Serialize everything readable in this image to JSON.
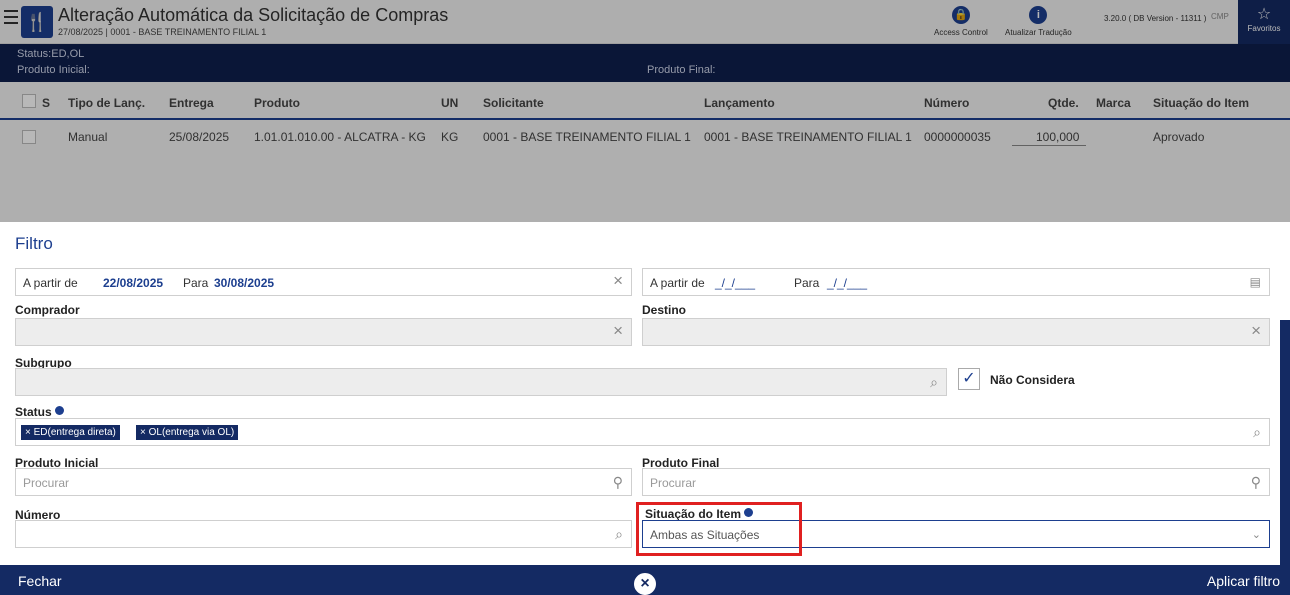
{
  "window": {
    "title": "Alteração Automática da Solicitação de Compras",
    "subtitle": "27/08/2025 | 0001 - BASE TREINAMENTO FILIAL 1",
    "access_control": "Access Control",
    "atualizar_traducao": "Atualizar Tradução",
    "version": "3.20.0 ( DB Version - 11311 )",
    "cmp": "CMP",
    "favoritos": "Favoritos"
  },
  "status_bar": {
    "status": "Status:ED,OL",
    "produto_inicial": "Produto Inicial:",
    "produto_final": "Produto Final:"
  },
  "grid": {
    "headers": [
      "S",
      "Tipo de Lanç.",
      "Entrega",
      "Produto",
      "UN",
      "Solicitante",
      "Lançamento",
      "Número",
      "Qtde.",
      "Marca",
      "Situação do Item"
    ],
    "row": {
      "tipo": "Manual",
      "entrega": "25/08/2025",
      "produto": "1.01.01.010.00 - ALCATRA - KG",
      "un": "KG",
      "solicitante": "0001 - BASE TREINAMENTO FILIAL 1",
      "lancamento": "0001 - BASE TREINAMENTO FILIAL 1",
      "numero": "0000000035",
      "qtde": "100,000",
      "marca": "",
      "situacao": "Aprovado"
    }
  },
  "filter": {
    "title": "Filtro",
    "date1": {
      "prefix": "A partir de",
      "from": "22/08/2025",
      "mid": "Para",
      "to": "30/08/2025"
    },
    "date2": {
      "prefix": "A partir de",
      "from": "_/_/___",
      "mid": "Para",
      "to": "_/_/___"
    },
    "comprador_label": "Comprador",
    "destino_label": "Destino",
    "subgrupo_label": "Subgrupo",
    "nao_considera": "Não Considera",
    "status_label": "Status",
    "status_chips": [
      "× ED(entrega direta)",
      "× OL(entrega via OL)"
    ],
    "produto_inicial_label": "Produto Inicial",
    "produto_final_label": "Produto Final",
    "procurar": "Procurar",
    "numero_label": "Número",
    "situacao_label": "Situação do Item",
    "situacao_value": "Ambas as Situações"
  },
  "footer": {
    "fechar": "Fechar",
    "aplicar": "Aplicar filtro"
  }
}
